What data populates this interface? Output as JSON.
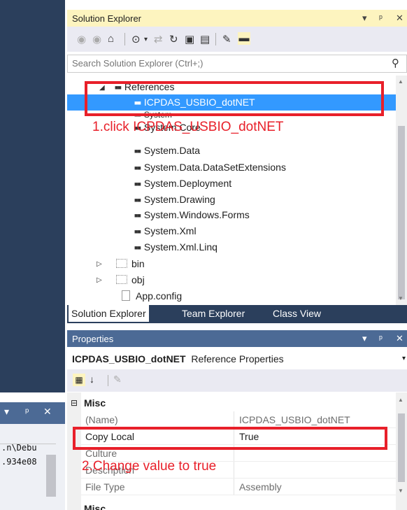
{
  "solution_explorer": {
    "title": "Solution Explorer",
    "controls": [
      "▾",
      "ᵖ",
      "✕"
    ],
    "search_placeholder": "Search Solution Explorer (Ctrl+;)",
    "tree": {
      "references_label": "References",
      "selected_reference": "ICPDAS_USBIO_dotNET",
      "references": [
        "System",
        "System.Core",
        "System.Data",
        "System.Data.DataSetExtensions",
        "System.Deployment",
        "System.Drawing",
        "System.Windows.Forms",
        "System.Xml",
        "System.Xml.Linq"
      ],
      "folders": [
        "bin",
        "obj"
      ],
      "file": "App.config"
    },
    "tabs": [
      "Solution Explorer",
      "Team Explorer",
      "Class View"
    ]
  },
  "properties": {
    "title": "Properties",
    "object_name": "ICPDAS_USBIO_dotNET",
    "object_type": "Reference Properties",
    "category": "Misc",
    "category2": "Misc",
    "rows": [
      {
        "name": "(Name)",
        "value": "ICPDAS_USBIO_dotNET"
      },
      {
        "name": "Copy Local",
        "value": "True"
      },
      {
        "name": "Culture",
        "value": ""
      },
      {
        "name": "Description",
        "value": ""
      },
      {
        "name": "File Type",
        "value": "Assembly"
      }
    ]
  },
  "left_panel": {
    "lines": [
      ".n\\Debu",
      ".934e08"
    ]
  },
  "annotations": {
    "step1": "1.click ICPDAS_USBIO_dotNET",
    "step2": "2.Change value to true"
  },
  "colors": {
    "selection": "#3399ff",
    "annotation_red": "#e8202a",
    "active_title": "#fdf4bf",
    "inactive_title": "#4c6a95"
  }
}
